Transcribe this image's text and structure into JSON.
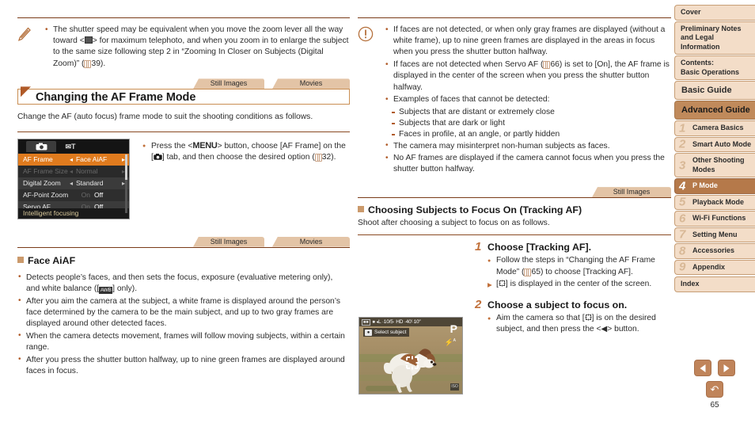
{
  "page": {
    "number": "65"
  },
  "left_column": {
    "note_callout": {
      "icon": "pencil-note-icon",
      "items": [
        "The shutter speed may be equivalent when you move the zoom lever all the way toward <⬜> for maximum telephoto, and when you zoom in to enlarge the subject to the same size following step 2 in “Zooming In Closer on Subjects (Digital Zoom)” (📖39)."
      ]
    },
    "tabs": [
      "Still Images",
      "Movies"
    ],
    "section_heading": "Changing the AF Frame Mode",
    "intro": "Change the AF (auto focus) frame mode to suit the shooting conditions as follows.",
    "menu_screenshot": {
      "tab_camera_icon": "camera-tab-icon",
      "tab_setup_icon": "setup-tab-icon",
      "rows": [
        {
          "label": "AF Frame",
          "value": "Face AiAF",
          "state": "selected"
        },
        {
          "label": "AF Frame Size",
          "value": "Normal",
          "state": "dimmed"
        },
        {
          "label": "Digital Zoom",
          "value": "Standard",
          "state": "normal"
        },
        {
          "label": "AF-Point Zoom",
          "value": "Off",
          "state": "toggle",
          "off_label": "On"
        },
        {
          "label": "Servo AF",
          "value": "Off",
          "state": "toggle",
          "off_label": "On"
        }
      ],
      "footer": "Intelligent focusing"
    },
    "menu_instruction": "Press the <MENU> button, choose [AF Frame] on the [📷] tab, and then choose the desired option (📖32).",
    "tabs2": [
      "Still Images",
      "Movies"
    ],
    "sub_heading": "Face AiAF",
    "bullets": [
      "Detects people’s faces, and then sets the focus, exposure (evaluative metering only), and white balance ([AWB] only).",
      "After you aim the camera at the subject, a white frame is displayed around the person’s face determined by the camera to be the main subject, and up to two gray frames are displayed around other detected faces.",
      "When the camera detects movement, frames will follow moving subjects, within a certain range.",
      "After you press the shutter button halfway, up to nine green frames are displayed around faces in focus."
    ]
  },
  "middle_column": {
    "warning_callout": {
      "icon": "warning-exclamation-icon",
      "items": [
        "If faces are not detected, or when only gray frames are displayed (without a white frame), up to nine green frames are displayed in the areas in focus when you press the shutter button halfway.",
        "If faces are not detected when Servo AF (📖66) is set to [On], the AF frame is displayed in the center of the screen when you press the shutter button halfway.",
        "Examples of faces that cannot be detected:"
      ],
      "sub_items": [
        "Subjects that are distant or extremely close",
        "Subjects that are dark or light",
        "Faces in profile, at an angle, or partly hidden"
      ],
      "items_after": [
        "The camera may misinterpret non-human subjects as faces.",
        "No AF frames are displayed if the camera cannot focus when you press the shutter button halfway."
      ]
    },
    "tabs": [
      "Still Images"
    ],
    "sub_heading": "Choosing Subjects to Focus On (Tracking AF)",
    "intro": "Shoot after choosing a subject to focus on as follows.",
    "steps": [
      {
        "number": "1",
        "title": "Choose [Tracking AF].",
        "bullets": [
          {
            "marker": "dot",
            "text": "Follow the steps in “Changing the AF Frame Mode” (📖65) to choose [Tracking AF]."
          },
          {
            "marker": "arrow",
            "text": "[✢] is displayed in the center of the screen."
          }
        ]
      },
      {
        "number": "2",
        "title": "Choose a subject to focus on.",
        "bullets": [
          {
            "marker": "dot",
            "text": "Aim the camera so that [✢] is on the desired subject, and then press the <◀> button."
          }
        ]
      }
    ],
    "photo_screenshot": {
      "status_bar": "⏹ ◂L ·10/5· HD ·40′·10″",
      "select_subject_label": "Select subject",
      "mode_label": "P",
      "flash_icon": "flash-auto-icon",
      "iso_icon": "iso-icon",
      "af_frame_icon": "tracking-af-frame-icon",
      "subject": "dog"
    }
  },
  "sidebar": {
    "items": [
      {
        "label": "Cover",
        "type": "plain"
      },
      {
        "label": "Preliminary Notes and Legal Information",
        "type": "plain"
      },
      {
        "label": "Contents:\nBasic Operations",
        "type": "plain"
      },
      {
        "label": "Basic Guide",
        "type": "big"
      },
      {
        "label": "Advanced Guide",
        "type": "guide"
      }
    ],
    "chapters": [
      {
        "num": "1",
        "label": "Camera Basics",
        "active": false
      },
      {
        "num": "2",
        "label": "Smart Auto Mode",
        "active": false
      },
      {
        "num": "3",
        "label": "Other Shooting Modes",
        "active": false
      },
      {
        "num": "4",
        "label": "P Mode",
        "active": true
      },
      {
        "num": "5",
        "label": "Playback Mode",
        "active": false
      },
      {
        "num": "6",
        "label": "Wi-Fi Functions",
        "active": false
      },
      {
        "num": "7",
        "label": "Setting Menu",
        "active": false
      },
      {
        "num": "8",
        "label": "Accessories",
        "active": false
      },
      {
        "num": "9",
        "label": "Appendix",
        "active": false
      }
    ],
    "index": {
      "label": "Index"
    },
    "nav": {
      "prev": "previous-page",
      "next": "next-page",
      "back": "back"
    }
  },
  "colors": {
    "accent_brown": "#b05a28",
    "tab_tan": "#e3c4a6",
    "sidebar_bg": "#f3ddc8",
    "sidebar_active": "#b5794a",
    "guide_bar": "#c08a5b"
  }
}
